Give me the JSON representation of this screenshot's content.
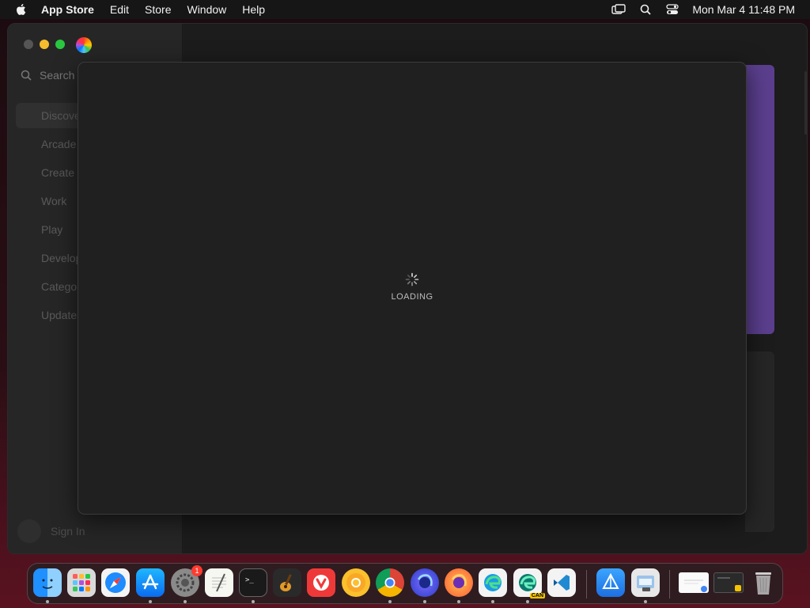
{
  "menubar": {
    "app_name": "App Store",
    "menus": [
      "Edit",
      "Store",
      "Window",
      "Help"
    ],
    "clock": "Mon Mar 4  11:48 PM"
  },
  "sidebar": {
    "search_placeholder": "Search",
    "items": [
      "Discover",
      "Arcade",
      "Create",
      "Work",
      "Play",
      "Develop",
      "Categories",
      "Updates"
    ],
    "sign_in": "Sign In"
  },
  "sheet": {
    "loading_text": "LOADING"
  },
  "dock": {
    "settings_badge": "1",
    "edge_can_label": "CAN",
    "apps": [
      "finder",
      "launchpad",
      "safari",
      "app-store",
      "system-settings",
      "textedit",
      "terminal",
      "garageband",
      "vivaldi",
      "chrome-canary",
      "chrome",
      "firefox-dev",
      "firefox",
      "edge",
      "edge-canary",
      "vscode",
      "xcode-instruments",
      "preview"
    ]
  },
  "colors": {
    "accent_purple": "#5b3f8e",
    "badge_red": "#ff3b30",
    "traffic_yellow": "#f5bd2e",
    "traffic_green": "#29c740"
  }
}
